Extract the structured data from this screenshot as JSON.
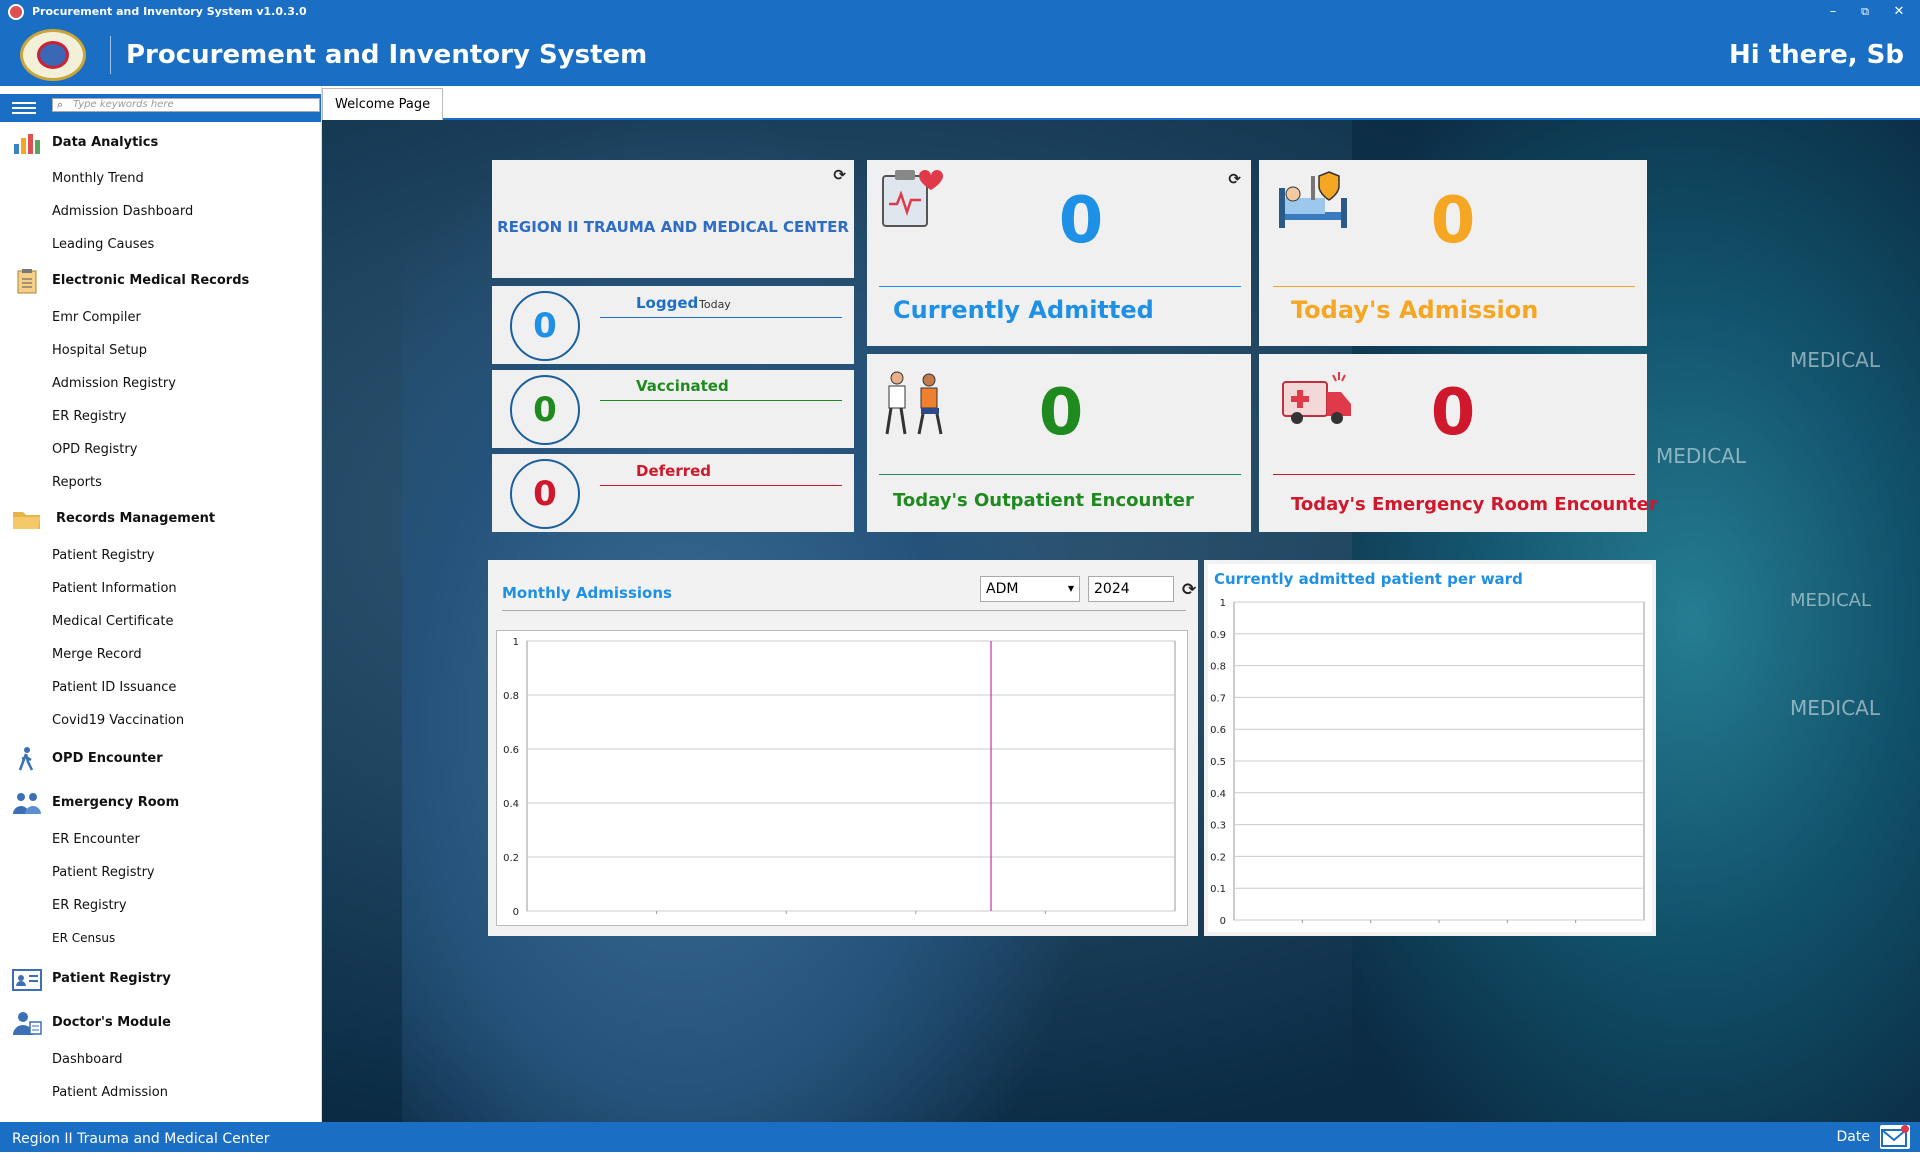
{
  "window": {
    "title": "Procurement and Inventory System v1.0.3.0",
    "min": "–",
    "restore": "⧉",
    "close": "✕"
  },
  "header": {
    "app_title": "Procurement and Inventory System",
    "greeting": "Hi there, Sb"
  },
  "sidebar": {
    "search_placeholder": "Type keywords here",
    "sections": {
      "data_analytics": {
        "label": "Data Analytics",
        "items": [
          "Monthly Trend",
          "Admission Dashboard",
          "Leading Causes"
        ]
      },
      "emr": {
        "label": "Electronic Medical Records",
        "items": [
          "Emr Compiler",
          "Hospital Setup",
          "Admission Registry",
          "ER Registry",
          "OPD Registry",
          "Reports"
        ]
      },
      "records": {
        "label": "Records Management",
        "items": [
          "Patient Registry",
          "Patient Information",
          "Medical Certificate",
          "Merge Record",
          "Patient ID Issuance",
          "Covid19 Vaccination"
        ]
      },
      "opd": {
        "label": "OPD Encounter"
      },
      "er": {
        "label": "Emergency Room",
        "items": [
          "ER Encounter",
          "Patient Registry",
          "ER Registry",
          "ER Census"
        ]
      },
      "patient_registry": {
        "label": "Patient Registry"
      },
      "doctors": {
        "label": "Doctor's Module",
        "items": [
          "Dashboard",
          "Patient Admission"
        ]
      }
    }
  },
  "tabs": {
    "welcome": "Welcome Page"
  },
  "hospital": {
    "name": "REGION II TRAUMA AND MEDICAL CENTER"
  },
  "vax": {
    "logged": {
      "label": "Logged",
      "sub": "Today",
      "value": "0"
    },
    "vaccinated": {
      "label": "Vaccinated",
      "value": "0"
    },
    "deferred": {
      "label": "Deferred",
      "value": "0"
    }
  },
  "stats": {
    "admitted": {
      "label": "Currently Admitted",
      "value": "0"
    },
    "today_admission": {
      "label": "Today's Admission",
      "value": "0"
    },
    "opd": {
      "label": "Today's Outpatient Encounter",
      "value": "0"
    },
    "er": {
      "label": "Today's Emergency Room Encounter",
      "value": "0"
    }
  },
  "monthly": {
    "title": "Monthly Admissions",
    "type_select": "ADM",
    "year": "2024"
  },
  "ward": {
    "title": "Currently admitted patient per ward"
  },
  "chart_data": [
    {
      "type": "line",
      "title": "Monthly Admissions",
      "ylim": [
        0,
        1
      ],
      "yticks": [
        "1",
        "0.8",
        "0.6",
        "0.4",
        "0.2",
        "0"
      ],
      "series": []
    },
    {
      "type": "bar",
      "title": "Currently admitted patient per ward",
      "ylim": [
        0,
        1
      ],
      "yticks": [
        "1",
        "0.9",
        "0.8",
        "0.7",
        "0.6",
        "0.5",
        "0.4",
        "0.3",
        "0.2",
        "0.1",
        "0"
      ],
      "series": []
    }
  ],
  "background_text": {
    "hex1": "MEDICAL",
    "hex2": "MEDICAL",
    "hex3": "MEDICAL",
    "hex4": "MEDICAL"
  },
  "footer": {
    "org": "Region II Trauma and Medical Center",
    "date_label": "Date"
  },
  "colors": {
    "primary": "#1a6fc4",
    "admitted": "#1e90e6",
    "admission": "#f5a623",
    "opd": "#1f8a1f",
    "er": "#d0182c"
  }
}
